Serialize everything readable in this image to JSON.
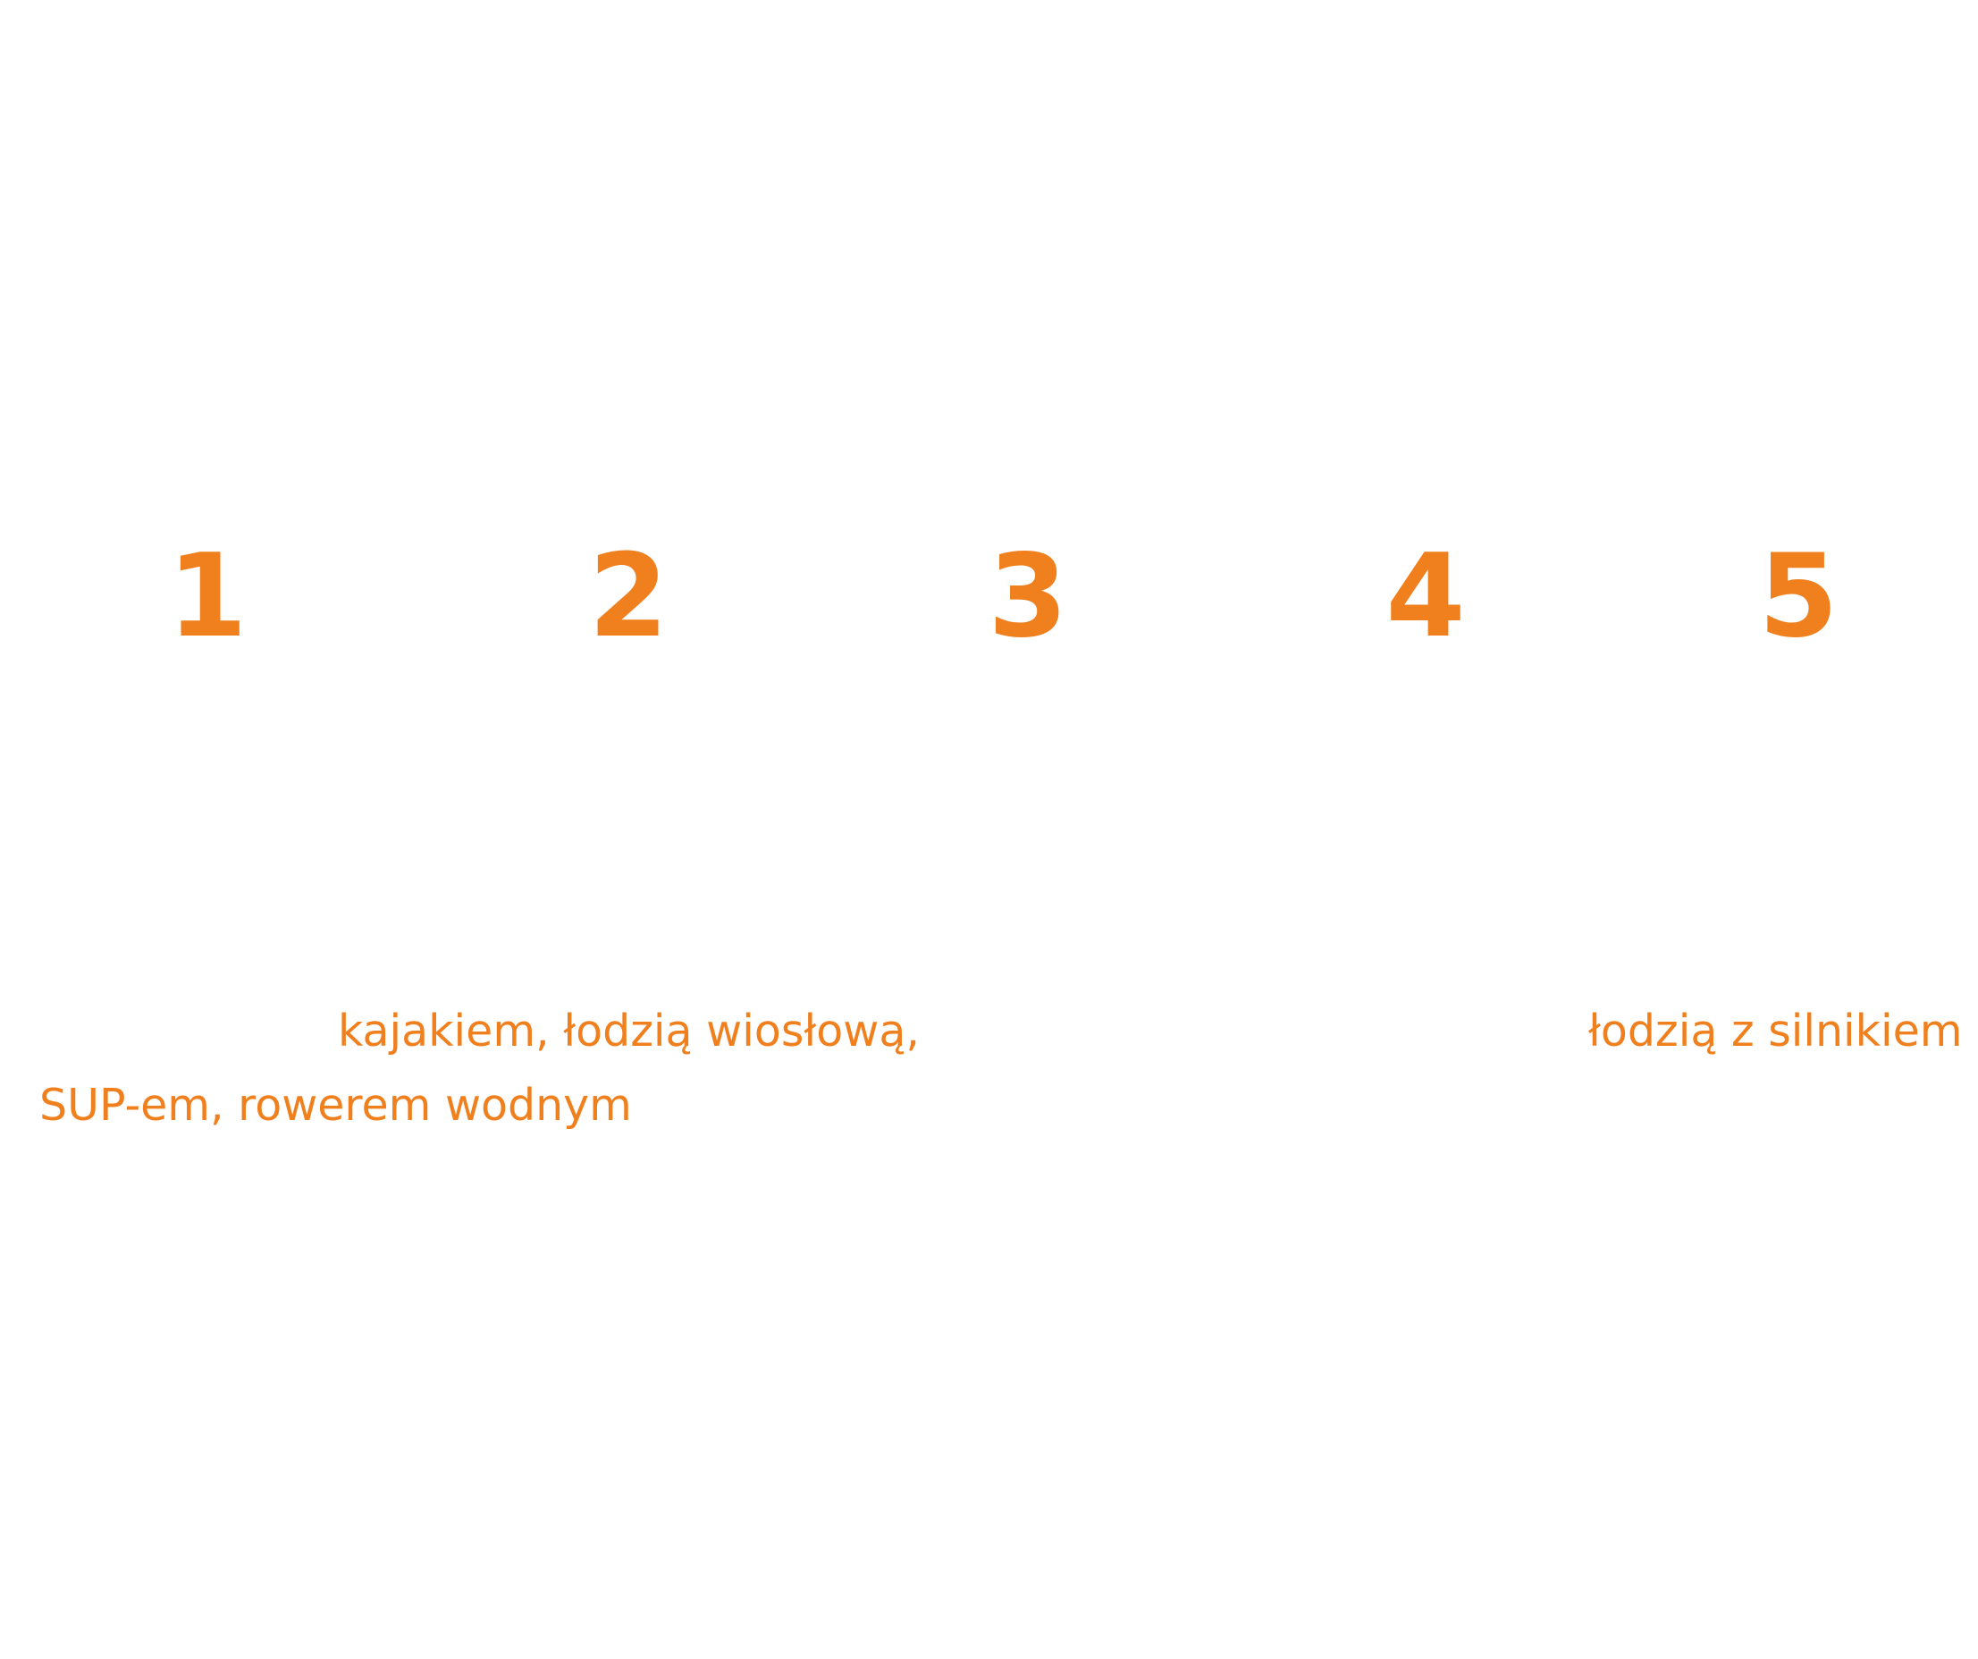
{
  "colors": {
    "accent": "#f07f1e",
    "background": "#ffffff"
  },
  "steps": [
    "1",
    "2",
    "3",
    "4",
    "5"
  ],
  "highlights": {
    "left_line_1": "kajakiem, łodzią wiosłową,",
    "left_line_2": "SUP-em, rowerem wodnym",
    "right_line_1": "łodzią z silnikiem"
  }
}
